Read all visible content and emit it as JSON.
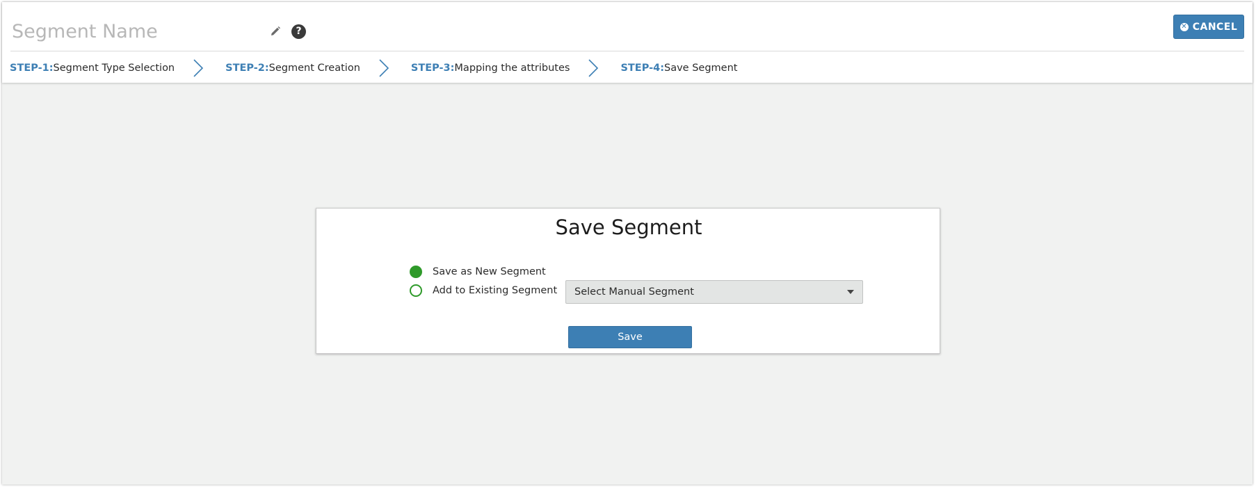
{
  "header": {
    "segment_name_placeholder": "Segment Name",
    "edit_icon": "pencil-icon",
    "help_icon": "question-icon",
    "help_glyph": "?",
    "cancel_label": "CANCEL",
    "cancel_icon": "close-circle-icon"
  },
  "steps": [
    {
      "num": "STEP-1",
      "label": "Segment Type Selection"
    },
    {
      "num": "STEP-2",
      "label": "Segment Creation"
    },
    {
      "num": "STEP-3",
      "label": "Mapping the attributes"
    },
    {
      "num": "STEP-4",
      "label": "Save Segment"
    }
  ],
  "step_separator": " : ",
  "card": {
    "title": "Save Segment",
    "options": [
      {
        "label": "Save as New Segment",
        "checked": true
      },
      {
        "label": "Add to Existing Segment",
        "checked": false
      }
    ],
    "select_value": "Select Manual Segment",
    "save_label": "Save"
  },
  "colors": {
    "primary": "#3d7fb4",
    "radio_green": "#2f9a2a",
    "background": "#f1f2f1"
  }
}
